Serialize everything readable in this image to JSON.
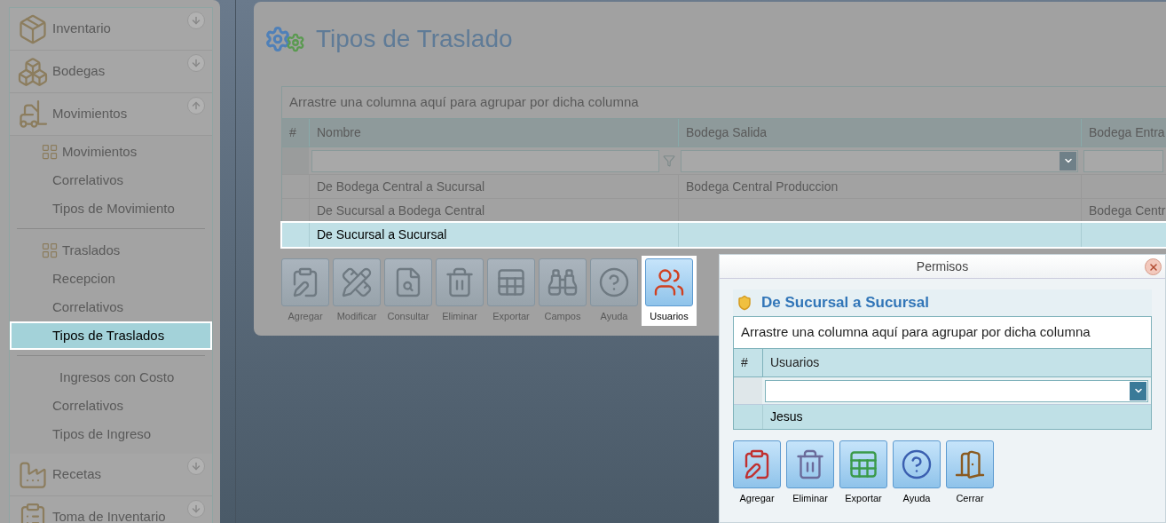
{
  "sidebar": {
    "sections": [
      {
        "label": "Inventario",
        "expanded": false
      },
      {
        "label": "Bodegas",
        "expanded": false
      },
      {
        "label": "Movimientos",
        "expanded": true,
        "groups": [
          {
            "label": "Movimientos",
            "kind": "icon",
            "items": [
              {
                "label": "Correlativos",
                "selected": false
              },
              {
                "label": "Tipos de Movimiento",
                "selected": false
              }
            ]
          },
          {
            "label": "Traslados",
            "kind": "icon",
            "items": [
              {
                "label": "Recepcion",
                "selected": false
              },
              {
                "label": "Correlativos",
                "selected": false
              },
              {
                "label": "Tipos de Traslados",
                "selected": true
              }
            ]
          },
          {
            "label": "Ingresos con Costo",
            "kind": "plain",
            "items": [
              {
                "label": "Correlativos",
                "selected": false
              },
              {
                "label": "Tipos de Ingreso",
                "selected": false
              }
            ]
          }
        ]
      },
      {
        "label": "Recetas",
        "expanded": false
      },
      {
        "label": "Toma de Inventario",
        "expanded": false
      }
    ]
  },
  "page": {
    "title": "Tipos de Traslado",
    "grid": {
      "group_panel": "Arrastre una columna aquí para agrupar por dicha columna",
      "columns": [
        {
          "label": "#"
        },
        {
          "label": "Nombre"
        },
        {
          "label": "Bodega Salida"
        },
        {
          "label": "Bodega Entra"
        }
      ],
      "filters": [
        {
          "kind": "none"
        },
        {
          "kind": "text"
        },
        {
          "kind": "dropdown"
        },
        {
          "kind": "text"
        }
      ],
      "rows": [
        {
          "cells": [
            "",
            "De Bodega Central a Sucursal",
            "Bodega Central Produccion",
            ""
          ],
          "selected": false
        },
        {
          "cells": [
            "",
            "De Sucursal a Bodega Central",
            "",
            "Bodega Centr"
          ],
          "selected": false
        },
        {
          "cells": [
            "",
            "De Sucursal a Sucursal",
            "",
            ""
          ],
          "selected": true
        }
      ]
    },
    "toolbar": [
      {
        "label": "Agregar",
        "selected": false
      },
      {
        "label": "Modificar",
        "selected": false
      },
      {
        "label": "Consultar",
        "selected": false
      },
      {
        "label": "Eliminar",
        "selected": false
      },
      {
        "label": "Exportar",
        "selected": false
      },
      {
        "label": "Campos",
        "selected": false
      },
      {
        "label": "Ayuda",
        "selected": false
      },
      {
        "label": "Usuarios",
        "selected": true
      }
    ]
  },
  "dialog": {
    "title": "Permisos",
    "heading": "De Sucursal a Sucursal",
    "grid": {
      "group_panel": "Arrastre una columna aquí para agrupar por dicha columna",
      "columns": [
        {
          "label": "#"
        },
        {
          "label": "Usuarios"
        }
      ],
      "filters": [
        {
          "kind": "none"
        },
        {
          "kind": "dropdown"
        }
      ],
      "rows": [
        {
          "cells": [
            "",
            "Jesus"
          ],
          "selected": true
        }
      ]
    },
    "buttons": [
      "Agregar",
      "Eliminar",
      "Exportar",
      "Ayuda",
      "Cerrar"
    ]
  }
}
